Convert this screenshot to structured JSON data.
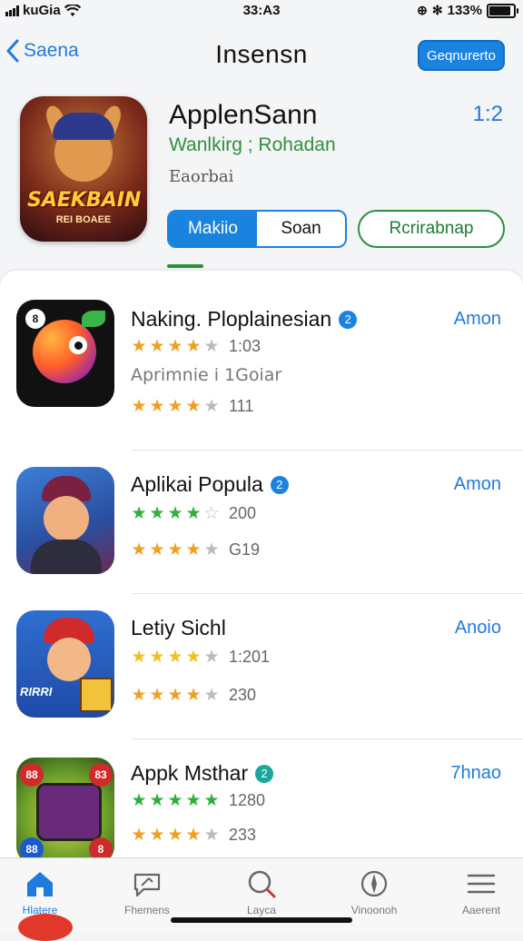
{
  "status": {
    "carrier": "kuGia",
    "time": "33:A3",
    "battery": "133%"
  },
  "nav": {
    "back_label": "Saena",
    "title": "Insensn",
    "action_label": "Geqnurerto"
  },
  "hero": {
    "name": "ApplenSann",
    "score": "1:2",
    "subtitle": "Wanlkirg ; Rohadan",
    "category": "Eaorbai",
    "icon_title": "SAEKBAIN",
    "icon_sub": "REI BOAEE",
    "segments": [
      "Makiio",
      "Soan"
    ],
    "pill_label": "Rcrirabnap"
  },
  "apps": [
    {
      "name": "Naking. Ploplainesian",
      "badge": "2",
      "action": "Amon",
      "rating_count": "1:03",
      "desc": "Aprimnie i 1Goiar",
      "rating_count2": "111"
    },
    {
      "name": "Aplikai Popula",
      "badge": "2",
      "action": "Amon",
      "rating_count": "200",
      "rating_count2": "G19"
    },
    {
      "name": "Letiy Sichl",
      "action": "Anoio",
      "rating_count": "1:201",
      "rating_count2": "230",
      "icon_tag": "RIRRI"
    },
    {
      "name": "Appk Msthar",
      "badge": "2",
      "action": "7hnao",
      "rating_count": "1280",
      "rating_count2": "233"
    }
  ],
  "app_icon_tags": {
    "a1": "8",
    "a4": [
      "88",
      "83",
      "88",
      "8"
    ]
  },
  "tabs": [
    {
      "label": "Hlatere",
      "icon": "home-icon"
    },
    {
      "label": "Fhemens",
      "icon": "message-icon"
    },
    {
      "label": "Layca",
      "icon": "search-icon"
    },
    {
      "label": "Vinoonoh",
      "icon": "compass-icon"
    },
    {
      "label": "Aaerent",
      "icon": "list-icon"
    }
  ],
  "colors": {
    "accent": "#1a83e0",
    "green": "#2f8f3c",
    "star": "#f0a020",
    "star_green": "#2fae3c"
  }
}
